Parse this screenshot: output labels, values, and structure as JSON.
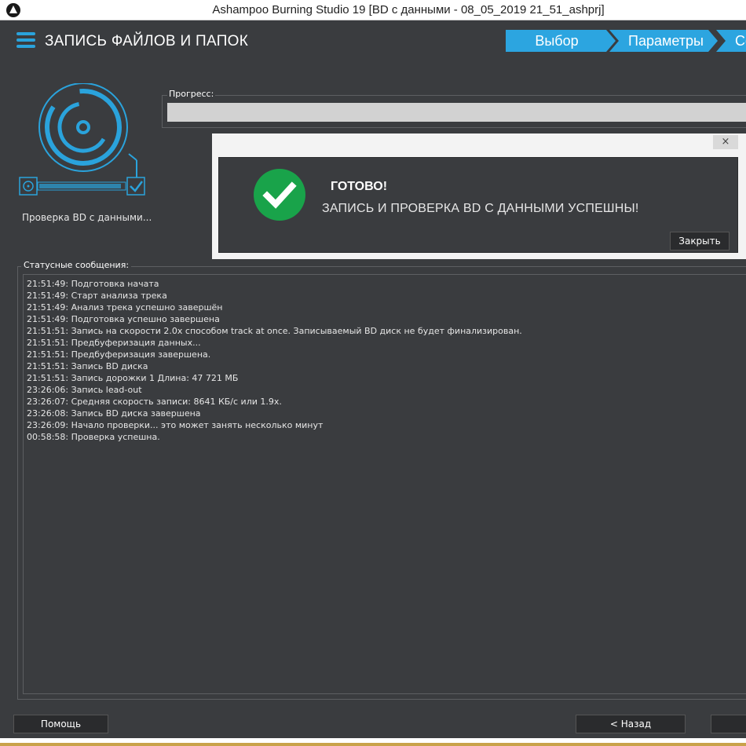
{
  "window": {
    "title": "Ashampoo Burning Studio 19 [BD с данными - 08_05_2019 21_51_ashprj]"
  },
  "header": {
    "title": "ЗАПИСЬ ФАЙЛОВ И ПАПОК",
    "steps": [
      {
        "label": "Выбор"
      },
      {
        "label": "Параметры"
      },
      {
        "label": "Со"
      }
    ]
  },
  "left_panel": {
    "caption": "Проверка BD с данными..."
  },
  "progress": {
    "label": "Прогресс:",
    "value_fraction": 0
  },
  "dialog": {
    "close_glyph": "×",
    "heading": "ГОТОВО!",
    "message": "ЗАПИСЬ И ПРОВЕРКА BD С ДАННЫМИ УСПЕШНЫ!",
    "button": "Закрыть"
  },
  "status": {
    "label": "Статусные сообщения:",
    "lines": [
      "21:51:49: Подготовка начата",
      "21:51:49: Старт анализа трека",
      "21:51:49: Анализ трека успешно завершён",
      "21:51:49: Подготовка успешно завершена",
      "21:51:51: Запись на скорости 2.0x способом track at once. Записываемый BD диск не будет финализирован.",
      "21:51:51: Предбуферизация данных...",
      "21:51:51: Предбуферизация завершена.",
      "21:51:51: Запись BD диска",
      "21:51:51: Запись дорожки 1 Длина: 47 721 МБ",
      "23:26:06: Запись lead-out",
      "23:26:07: Средняя скорость записи: 8641 КБ/с или 1.9x.",
      "23:26:08: Запись BD диска завершена",
      "23:26:09: Начало проверки... это может занять несколько минут",
      "00:58:58: Проверка успешна."
    ]
  },
  "footer": {
    "help": "Помощь",
    "back": "< Назад",
    "next": ""
  },
  "colors": {
    "accent": "#2ca5e0",
    "success": "#19a34a",
    "background": "#3a3c3f"
  }
}
